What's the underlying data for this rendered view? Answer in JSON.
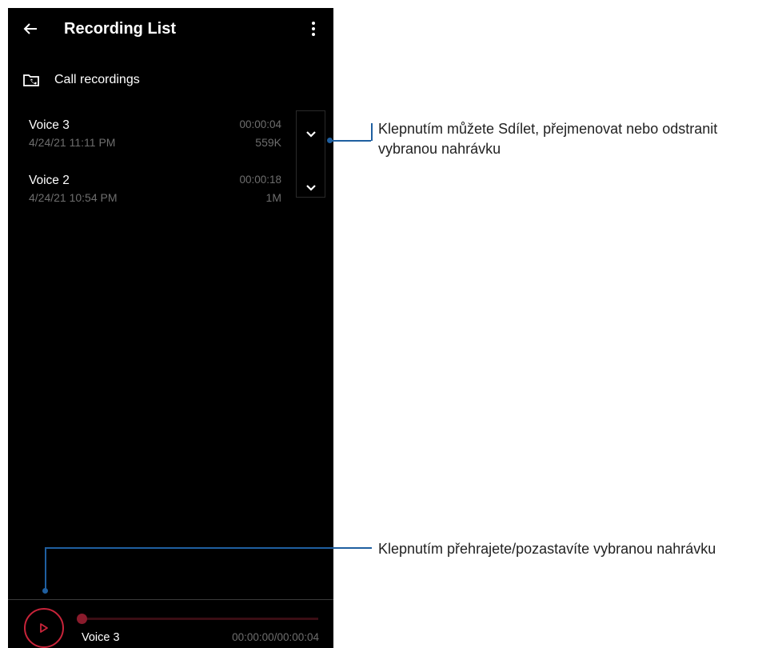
{
  "header": {
    "title": "Recording List",
    "back_icon": "arrow-left-icon",
    "menu_icon": "more-vert-icon"
  },
  "folder": {
    "icon": "folder-call-icon",
    "label": "Call recordings"
  },
  "recordings": [
    {
      "name": "Voice 3",
      "date": "4/24/21 11:11 PM",
      "duration": "00:00:04",
      "size": "559K"
    },
    {
      "name": "Voice 2",
      "date": "4/24/21 10:54 PM",
      "duration": "00:00:18",
      "size": "1M"
    }
  ],
  "player": {
    "track_name": "Voice 3",
    "time": "00:00:00/00:00:04",
    "progress_fraction": 0.0
  },
  "annotations": {
    "expand": {
      "text": "Klepnutím můžete Sdílet, přejmenovat nebo odstranit vybranou nahrávku"
    },
    "play": {
      "text": "Klepnutím přehrajete/pozastavíte vybranou nahrávku"
    }
  },
  "colors": {
    "accent": "#c8243a",
    "callout": "#1f5fa0",
    "background": "#000000",
    "secondary_text": "#6e6e6e"
  }
}
